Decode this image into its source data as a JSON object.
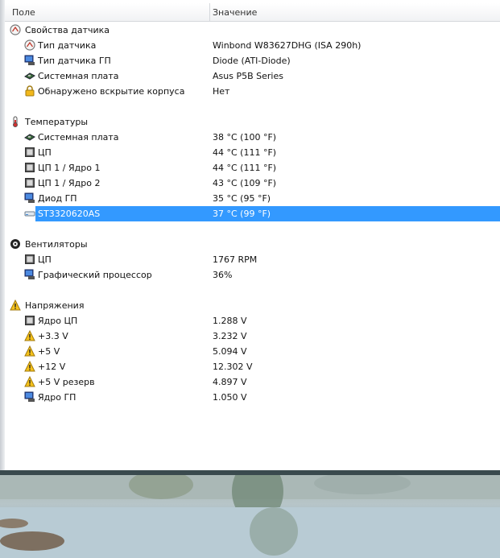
{
  "columns": {
    "field": "Поле",
    "value": "Значение"
  },
  "groups": [
    {
      "title": "Свойства датчика",
      "icon": "gauge-icon",
      "items": [
        {
          "name": "Тип датчика",
          "value": "Winbond W83627DHG  (ISA 290h)",
          "icon": "gauge-icon"
        },
        {
          "name": "Тип датчика ГП",
          "value": "Diode  (ATI-Diode)",
          "icon": "gpu-monitor-icon"
        },
        {
          "name": "Системная плата",
          "value": "Asus P5B Series",
          "icon": "motherboard-icon"
        },
        {
          "name": "Обнаружено вскрытие корпуса",
          "value": "Нет",
          "icon": "lock-icon"
        }
      ]
    },
    {
      "title": "Температуры",
      "icon": "thermometer-icon",
      "items": [
        {
          "name": "Системная плата",
          "value": "38 °C  (100 °F)",
          "icon": "motherboard-icon"
        },
        {
          "name": "ЦП",
          "value": "44 °C  (111 °F)",
          "icon": "cpu-chip-icon"
        },
        {
          "name": "ЦП 1 / Ядро 1",
          "value": "44 °C  (111 °F)",
          "icon": "cpu-chip-icon"
        },
        {
          "name": "ЦП 1 / Ядро 2",
          "value": "43 °C  (109 °F)",
          "icon": "cpu-chip-icon"
        },
        {
          "name": "Диод ГП",
          "value": "35 °C  (95 °F)",
          "icon": "gpu-monitor-icon"
        },
        {
          "name": "ST3320620AS",
          "value": "37 °C  (99 °F)",
          "icon": "hard-drive-icon",
          "selected": true
        }
      ]
    },
    {
      "title": "Вентиляторы",
      "icon": "fan-icon",
      "items": [
        {
          "name": "ЦП",
          "value": "1767 RPM",
          "icon": "cpu-chip-icon"
        },
        {
          "name": "Графический процессор",
          "value": "36%",
          "icon": "gpu-monitor-icon"
        }
      ]
    },
    {
      "title": "Напряжения",
      "icon": "warning-icon",
      "items": [
        {
          "name": "Ядро ЦП",
          "value": "1.288 V",
          "icon": "cpu-chip-icon"
        },
        {
          "name": "+3.3 V",
          "value": "3.232 V",
          "icon": "warning-icon"
        },
        {
          "name": "+5 V",
          "value": "5.094 V",
          "icon": "warning-icon"
        },
        {
          "name": "+12 V",
          "value": "12.302 V",
          "icon": "warning-icon"
        },
        {
          "name": "+5 V резерв",
          "value": "4.897 V",
          "icon": "warning-icon"
        },
        {
          "name": "Ядро ГП",
          "value": "1.050 V",
          "icon": "gpu-monitor-icon"
        }
      ]
    }
  ],
  "colors": {
    "selection": "#3399ff",
    "header_text": "#333333"
  }
}
